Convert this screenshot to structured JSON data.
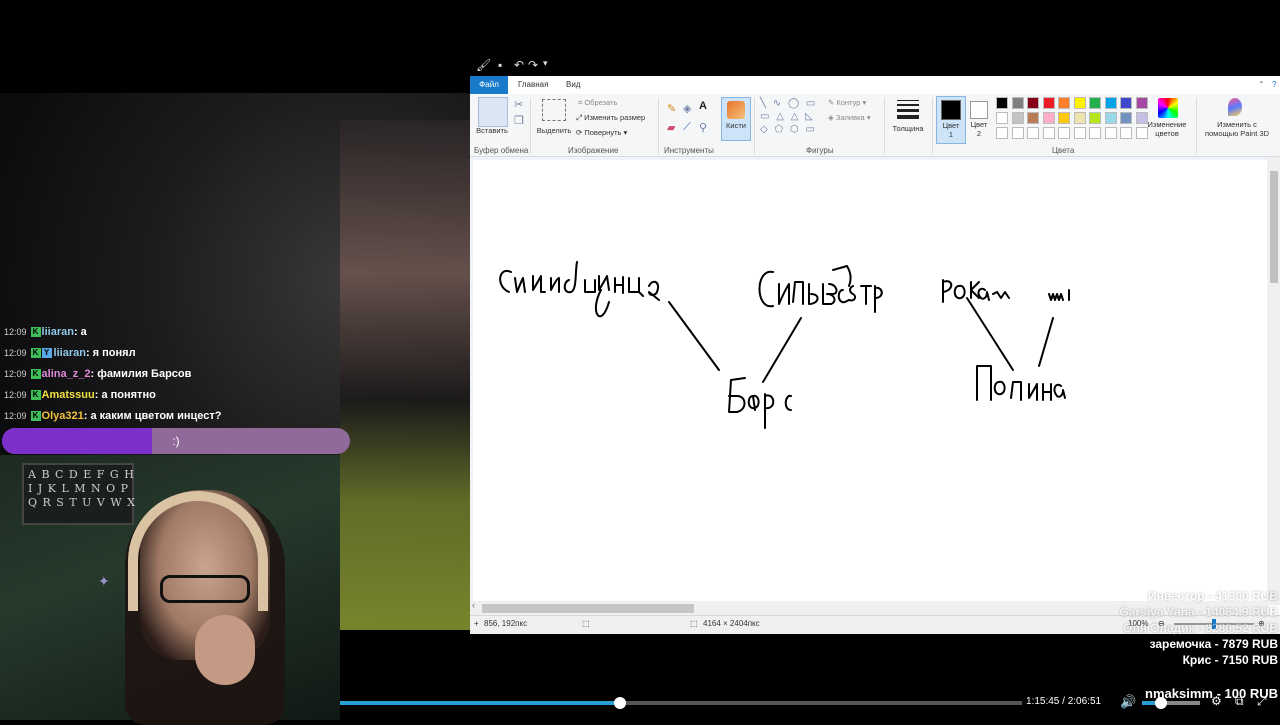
{
  "chat": [
    {
      "time": "12:09",
      "badges": [
        "K"
      ],
      "user": "liiaran",
      "user_color": "#8fc8e8",
      "text": "а"
    },
    {
      "time": "12:09",
      "badges": [
        "K",
        "Y"
      ],
      "user": "liiaran",
      "user_color": "#8fc8e8",
      "text": "я понял"
    },
    {
      "time": "12:09",
      "badges": [
        "K"
      ],
      "user": "alina_z_2",
      "user_color": "#e08ad8",
      "text": "фамилия Барсов"
    },
    {
      "time": "12:09",
      "badges": [
        "K"
      ],
      "user": "Amatssuu",
      "user_color": "#f0e040",
      "text": "а понятно"
    },
    {
      "time": "12:09",
      "badges": [
        "K"
      ],
      "user": "Olya321",
      "user_color": "#f0c040",
      "text": "а каким цветом инцест?"
    }
  ],
  "progress": {
    "label": ":)",
    "fraction": 0.43
  },
  "webcam": {
    "board_text": "A B C D E F G H\nI J K L M N O P\nQ R S T U V W X"
  },
  "paint": {
    "tabs": {
      "file": "Файл",
      "home": "Главная",
      "view": "Вид"
    },
    "clipboard": {
      "paste": "Вставить",
      "group": "Буфер обмена"
    },
    "image": {
      "select": "Выделить",
      "crop": "Обрезать",
      "resize": "Изменить размер",
      "rotate": "Повернуть",
      "group": "Изображение"
    },
    "tools": {
      "group": "Инструменты",
      "brushes": "Кисти"
    },
    "shapes": {
      "outline": "Контур",
      "fill": "Заливка",
      "group": "Фигуры"
    },
    "size": {
      "label": "Толщина"
    },
    "color1": {
      "label": "Цвет\n1"
    },
    "color2": {
      "label": "Цвет\n2"
    },
    "colors": {
      "group": "Цвета",
      "edit": "Изменение\nцветов",
      "paint3d": "Изменить с\nпомощью Paint 3D",
      "palette": [
        "#000000",
        "#7f7f7f",
        "#880015",
        "#ed1c24",
        "#ff7f27",
        "#fff200",
        "#22b14c",
        "#00a2e8",
        "#3f48cc",
        "#a349a4",
        "#ffffff",
        "#c3c3c3",
        "#b97a57",
        "#ffaec9",
        "#ffc90e",
        "#efe4b0",
        "#b5e61d",
        "#99d9ea",
        "#7092be",
        "#c8bfe7"
      ]
    },
    "canvas_words": [
      "Суицидница",
      "Сильвестр",
      "пока…ли",
      "Барс",
      "Полина"
    ],
    "status": {
      "cursor": "856, 192пкс",
      "size": "4164 × 2404пкс",
      "zoom": "100%"
    }
  },
  "donations": [
    {
      "text": "Инвестор - 41300 RUB",
      "faded": true
    },
    {
      "text": "Garsiya Yana - 14064.9 RUB",
      "faded": true
    },
    {
      "text": "Оля Оладик - 8280.52 RUB",
      "faded": true
    },
    {
      "text": "заремочка - 7879 RUB",
      "faded": false
    },
    {
      "text": "Крис - 7150 RUB",
      "faded": false
    }
  ],
  "donation_last": "nmaksimm - 100 RUB",
  "player": {
    "current": "1:15:45",
    "duration": "2:06:51",
    "separator": "/",
    "progress_fraction": 0.411,
    "volume_fraction": 0.33
  }
}
